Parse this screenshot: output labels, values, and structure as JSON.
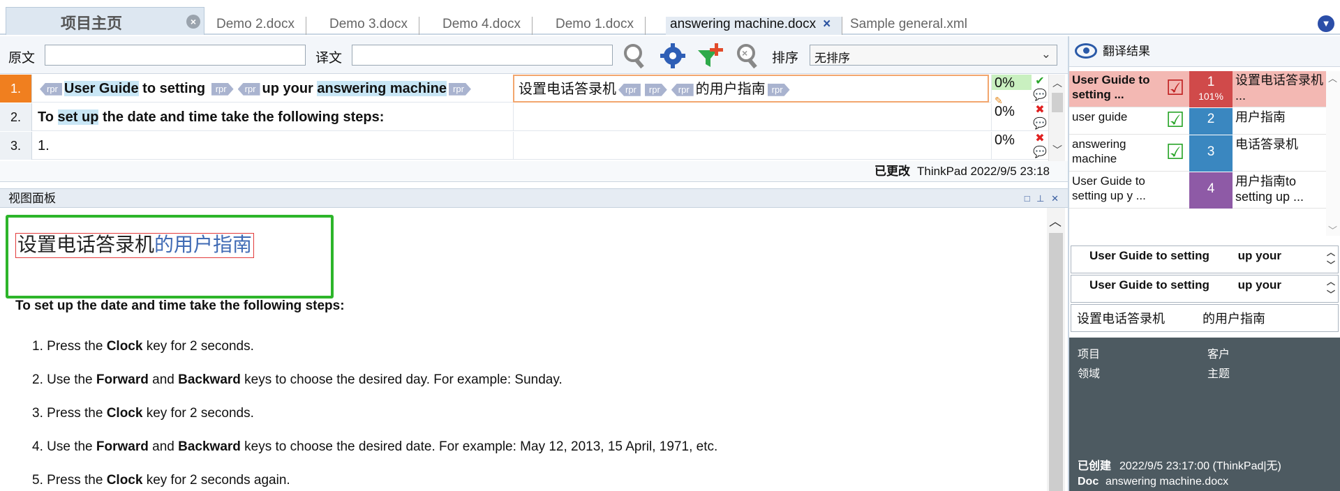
{
  "tabs": {
    "home": "项目主页",
    "docs": [
      "Demo 2.docx",
      "Demo 3.docx",
      "Demo 4.docx",
      "Demo 1.docx",
      "answering machine.docx",
      "Sample general.xml"
    ],
    "active_index": 4
  },
  "search": {
    "source_label": "原文",
    "target_label": "译文",
    "sort_label": "排序",
    "sort_value": "无排序",
    "source_value": "",
    "target_value": ""
  },
  "grid": {
    "rows": [
      {
        "num": "1.",
        "src_parts": [
          "User Guide",
          "to setting",
          "up your",
          "answering machine"
        ],
        "tgt_parts": [
          "设置电话答录机",
          "的用户指南"
        ],
        "tag": "rpr",
        "pct": "0%",
        "status": "check"
      },
      {
        "num": "2.",
        "src_text_a": "To",
        "src_hl": "set up",
        "src_text_b": "the date and time take the following steps:",
        "tgt": "",
        "pct": "0%",
        "status": "cross"
      },
      {
        "num": "3.",
        "src": "1.",
        "tgt": "",
        "pct": "0%",
        "status": "cross"
      }
    ],
    "edit_status": "已更改",
    "edit_info": "ThinkPad 2022/9/5 23:18"
  },
  "view_panel": {
    "title": "视图面板",
    "zh_title_a": "设置电话答录机",
    "zh_title_b": "的用户指南",
    "intro": "To set up the date and time take the following steps:",
    "steps": [
      {
        "n": "1.",
        "a": "Press the ",
        "b1": "Clock",
        "c": " key for 2 seconds.",
        "b2": "",
        "d": ""
      },
      {
        "n": "2.",
        "a": "Use the ",
        "b1": "Forward",
        "c": " and ",
        "b2": "Backward",
        "d": " keys to choose the desired day. For example: Sunday."
      },
      {
        "n": "3.",
        "a": "Press the ",
        "b1": "Clock",
        "c": " key for 2 seconds.",
        "b2": "",
        "d": ""
      },
      {
        "n": "4.",
        "a": "Use the ",
        "b1": "Forward",
        "c": " and ",
        "b2": "Backward",
        "d": " keys to choose the desired date. For example: May 12, 2013, 15 April, 1971, etc."
      },
      {
        "n": "5.",
        "a": "Press the ",
        "b1": "Clock",
        "c": " key for 2 seconds again.",
        "b2": "",
        "d": ""
      }
    ]
  },
  "results": {
    "title": "翻译结果",
    "tm": [
      {
        "src": "User Guide to setting ...",
        "num": "1",
        "sub": "101%",
        "tgt": "设置电话答录机 ...",
        "color": "#d04a4a",
        "bg": "#f3b8b3"
      },
      {
        "src": "user guide",
        "num": "2",
        "sub": "",
        "tgt": "用户指南",
        "color": "#3a87c0",
        "bg": "#fff"
      },
      {
        "src": "answering machine",
        "num": "3",
        "sub": "",
        "tgt": "电话答录机",
        "color": "#3a87c0",
        "bg": "#fff"
      },
      {
        "src": "User Guide to setting up y ...",
        "num": "4",
        "sub": "",
        "tgt": "用户指南to setting up ...",
        "color": "#8e5aa6",
        "bg": "#fff"
      }
    ],
    "compare1": "User Guide to setting",
    "compare1b": "up your",
    "compare2": "User Guide to setting",
    "compare2b": "up your",
    "target_preview_a": "设置电话答录机",
    "target_preview_b": "的用户指南",
    "meta": {
      "project_label": "项目",
      "client_label": "客户",
      "domain_label": "领域",
      "subject_label": "主题",
      "created_label": "已创建",
      "created_value": "2022/9/5 23:17:00 (ThinkPad|无)",
      "doc_label": "Doc",
      "doc_value": "answering machine.docx"
    }
  }
}
